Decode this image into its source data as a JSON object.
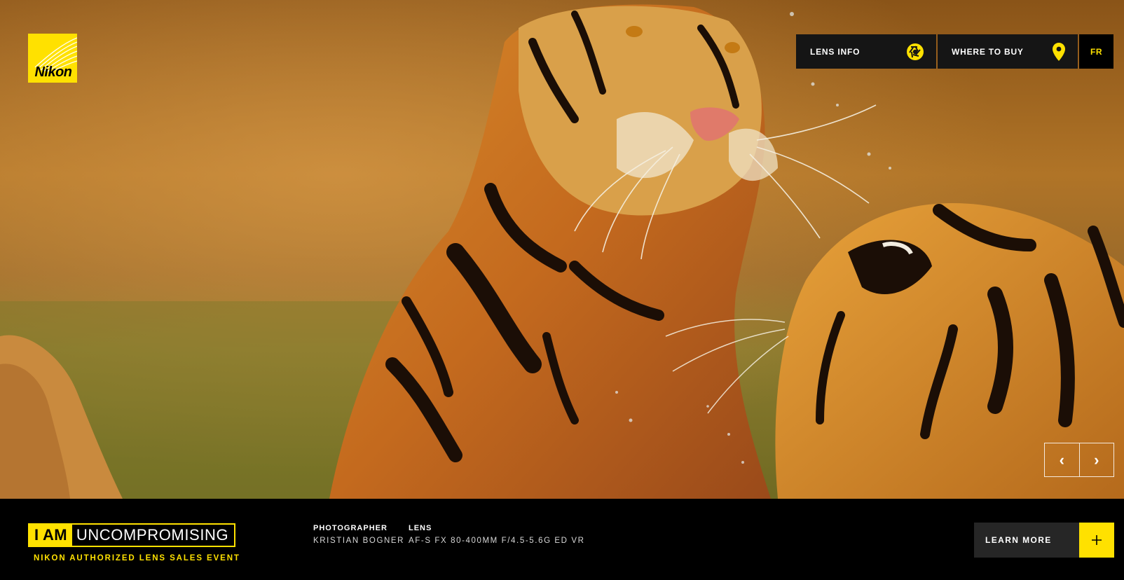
{
  "brand": {
    "logo_text": "Nikon",
    "accent_color": "#ffe100"
  },
  "nav": {
    "lens_info": {
      "label": "LENS INFO",
      "icon": "aperture-icon"
    },
    "where_to_buy": {
      "label": "WHERE TO BUY",
      "icon": "map-pin-icon"
    },
    "language": "FR"
  },
  "hero": {
    "image_subject": "tigers-photo",
    "prev_arrow": "‹",
    "next_arrow": "›"
  },
  "footer": {
    "tagline_highlight": "I AM",
    "tagline_word": "UNCOMPROMISING",
    "subtitle": "NIKON AUTHORIZED LENS SALES EVENT",
    "photographer_heading": "PHOTOGRAPHER",
    "photographer_name": "KRISTIAN BOGNER",
    "lens_heading": "LENS",
    "lens_name": "AF-S FX 80-400MM F/4.5-5.6G ED VR",
    "learn_more": "LEARN MORE",
    "learn_more_icon": "plus-icon"
  }
}
